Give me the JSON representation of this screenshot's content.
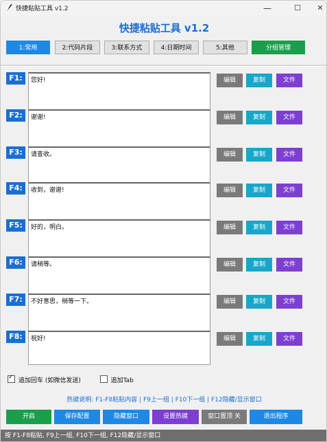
{
  "window": {
    "title": "快捷粘贴工具 v1.2",
    "minimize": "—",
    "maximize": "☐",
    "close": "✕"
  },
  "app_title": "快捷粘贴工具 v1.2",
  "tabs": [
    "1:常用",
    "2:代码片段",
    "3:联系方式",
    "4:日期时间",
    "5:其他"
  ],
  "group_button": "分组管理",
  "buttons": {
    "edit": "编辑",
    "copy": "复制",
    "file": "文件"
  },
  "rows": [
    {
      "key": "F1:",
      "text": "您好!"
    },
    {
      "key": "F2:",
      "text": "谢谢!"
    },
    {
      "key": "F3:",
      "text": "请查收。"
    },
    {
      "key": "F4:",
      "text": "收到，谢谢!"
    },
    {
      "key": "F5:",
      "text": "好的，明白。"
    },
    {
      "key": "F6:",
      "text": "请稍等。"
    },
    {
      "key": "F7:",
      "text": "不好意思，稍等一下。"
    },
    {
      "key": "F8:",
      "text": "祝好!"
    }
  ],
  "options": {
    "append_enter": "追加回车 (如微信发送)",
    "append_tab": "追加Tab"
  },
  "hotkey_info": "热键说明: F1-F8粘贴内容 | F9上一组 | F10下一组 | F12隐藏/显示窗口",
  "bottom_buttons": [
    "开启",
    "保存配置",
    "隐藏窗口",
    "设置热键",
    "窗口置顶 关",
    "退出程序"
  ],
  "status": "按 F1-F8粘贴, F9上一组, F10下一组, F12隐藏/显示窗口",
  "colors": {
    "accent": "#1a6fd1",
    "tab_active": "#1e88e5",
    "green": "#1b9e4b",
    "cyan": "#18a6c9",
    "purple": "#7c3fd1",
    "gray": "#7a7a7a"
  }
}
